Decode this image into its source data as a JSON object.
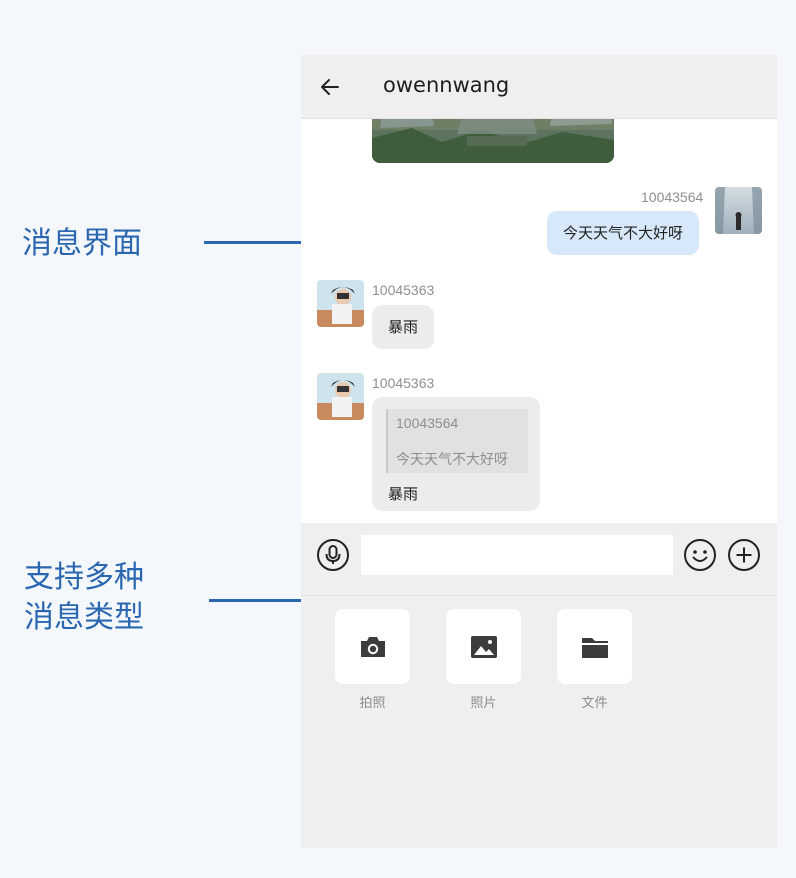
{
  "annotations": {
    "chat_ui": "消息界面",
    "multi_type": "支持多种\n消息类型"
  },
  "header": {
    "title": "owennwang"
  },
  "messages": {
    "outgoing": {
      "sender_id": "10043564",
      "text": "今天天气不大好呀"
    },
    "incoming1": {
      "sender_id": "10045363",
      "text": "暴雨"
    },
    "incoming2": {
      "sender_id": "10045363",
      "quote_sender_id": "10043564",
      "quote_text": "今天天气不大好呀",
      "text": "暴雨"
    }
  },
  "input": {
    "value": "",
    "placeholder": ""
  },
  "tools": [
    {
      "label": "拍照",
      "icon": "camera-icon"
    },
    {
      "label": "照片",
      "icon": "image-icon"
    },
    {
      "label": "文件",
      "icon": "folder-icon"
    }
  ],
  "colors": {
    "accent": "#2b67b0",
    "outgoing_bubble": "#d7e8fb",
    "incoming_bubble": "#ececec"
  }
}
